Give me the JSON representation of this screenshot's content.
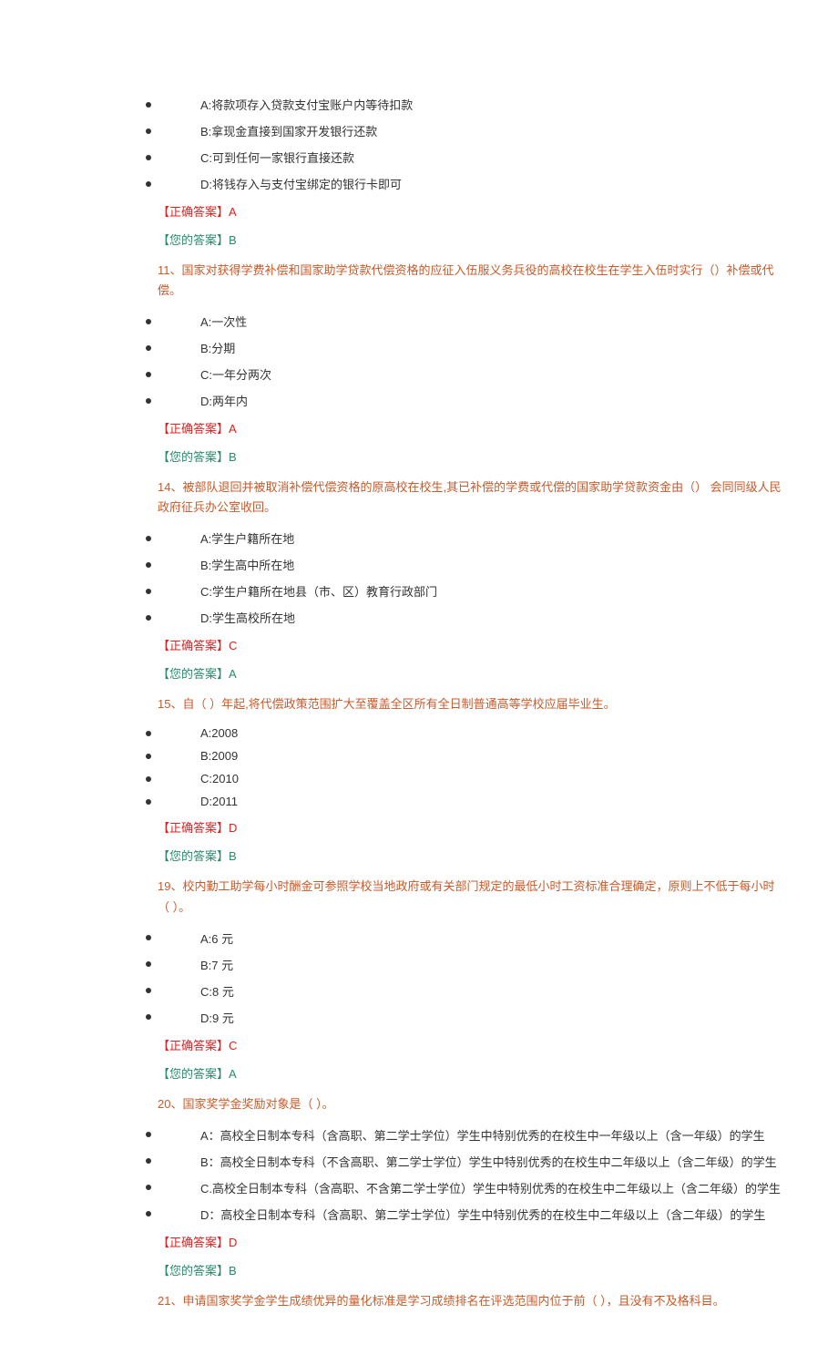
{
  "questions": [
    {
      "options": [
        "A:将款项存入贷款支付宝账户内等待扣款",
        "B:拿现金直接到国家开发银行还款",
        "C:可到任何一家银行直接还款",
        "D:将钱存入与支付宝绑定的银行卡即可"
      ],
      "correct": "【正确答案】A",
      "your": "【您的答案】B"
    },
    {
      "stem": "11、国家对获得学费补偿和国家助学贷款代偿资格的应征入伍服义务兵役的高校在校生在学生入伍时实行（）补偿或代偿。",
      "options": [
        "A:一次性",
        "B:分期",
        "C:一年分两次",
        "D:两年内"
      ],
      "correct": "【正确答案】A",
      "your": "【您的答案】B"
    },
    {
      "stem": "14、被部队退回并被取消补偿代偿资格的原高校在校生,其已补偿的学费或代偿的国家助学贷款资金由（）  会同同级人民政府征兵办公室收回。",
      "options": [
        "A:学生户籍所在地",
        "B:学生高中所在地",
        "C:学生户籍所在地县（市、区）教育行政部门",
        "D:学生高校所在地"
      ],
      "correct": "【正确答案】C",
      "your": "【您的答案】A"
    },
    {
      "stem": "15、自（ ）年起,将代偿政策范围扩大至覆盖全区所有全日制普通高等学校应届毕业生。",
      "options": [
        "A:2008",
        "B:2009",
        "C:2010",
        "D:2011"
      ],
      "correct": "【正确答案】D",
      "your": "【您的答案】B"
    },
    {
      "stem": "19、校内勤工助学每小时酬金可参照学校当地政府或有关部门规定的最低小时工资标准合理确定，原则上不低于每小时（ ）。",
      "options": [
        "A:6 元",
        "B:7 元",
        "C:8 元",
        "D:9 元"
      ],
      "correct": "【正确答案】C",
      "your": "【您的答案】A"
    },
    {
      "stem": "20、国家奖学金奖励对象是（ ）。",
      "options": [
        "A：高校全日制本专科（含高职、第二学士学位）学生中特别优秀的在校生中一年级以上（含一年级）的学生",
        "B：高校全日制本专科（不含高职、第二学士学位）学生中特别优秀的在校生中二年级以上（含二年级）的学生",
        "C.高校全日制本专科（含高职、不含第二学士学位）学生中特别优秀的在校生中二年级以上（含二年级）的学生",
        "D：高校全日制本专科（含高职、第二学士学位）学生中特别优秀的在校生中二年级以上（含二年级）的学生"
      ],
      "correct": "【正确答案】D",
      "your": "【您的答案】B"
    },
    {
      "stem": "21、申请国家奖学金学生成绩优异的量化标准是学习成绩排名在评选范围内位于前（ ），且没有不及格科目。"
    }
  ]
}
